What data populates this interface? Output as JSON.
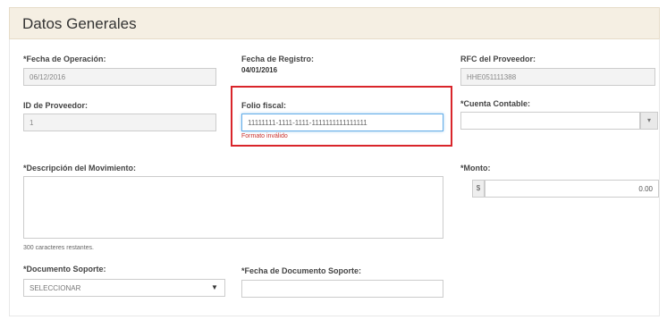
{
  "header": {
    "title": "Datos Generales"
  },
  "form": {
    "fecha_operacion": {
      "label": "*Fecha de Operación:",
      "value": "06/12/2016"
    },
    "fecha_registro": {
      "label": "Fecha de Registro:",
      "value": "04/01/2016"
    },
    "rfc_proveedor": {
      "label": "RFC del Proveedor:",
      "value": "HHE051111388"
    },
    "id_proveedor": {
      "label": "ID de Proveedor:",
      "value": "1"
    },
    "folio_fiscal": {
      "label": "Folio fiscal:",
      "value": "11111111-1111-1111-1111111111111111",
      "error": "Formato inválido"
    },
    "cuenta_contable": {
      "label": "*Cuenta Contable:",
      "value": "",
      "button_icon": "chevron-down-icon"
    },
    "descripcion": {
      "label": "*Descripción del Movimiento:",
      "value": "",
      "counter": "300 caracteres restantes."
    },
    "monto": {
      "label": "*Monto:",
      "currency": "$",
      "value": "0.00"
    },
    "documento_soporte": {
      "label": "*Documento Soporte:",
      "value": "SELECCIONAR"
    },
    "fecha_documento": {
      "label": "*Fecha de Documento Soporte:",
      "value": ""
    }
  },
  "colors": {
    "highlight": "#d9252b",
    "header_bg": "#f5efe3",
    "error": "#c9302c"
  }
}
